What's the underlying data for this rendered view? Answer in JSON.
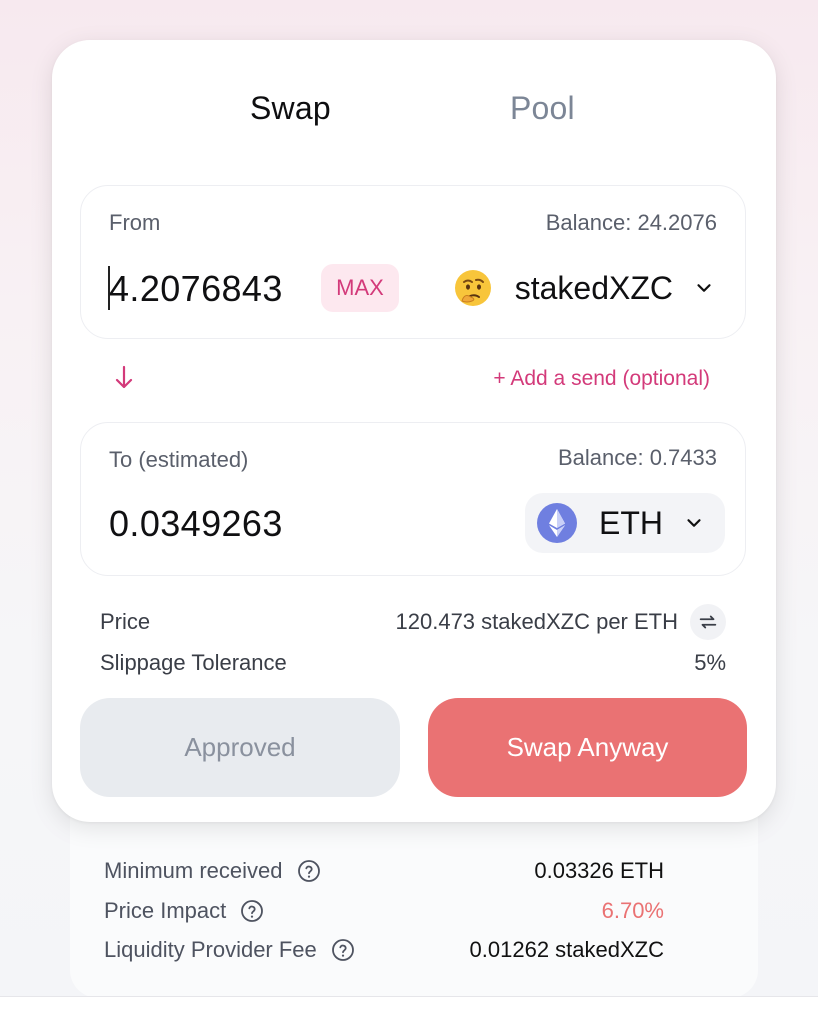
{
  "tabs": {
    "swap": "Swap",
    "pool": "Pool"
  },
  "from": {
    "label": "From",
    "balance": "Balance: 24.2076",
    "amount": "4.2076843",
    "max_label": "MAX",
    "token": "stakedXZC",
    "token_icon": "thinking-face-emoji"
  },
  "add_send": "+ Add a send (optional)",
  "to": {
    "label": "To (estimated)",
    "balance": "Balance: 0.7433",
    "amount": "0.0349263",
    "token": "ETH",
    "token_icon": "ethereum-icon"
  },
  "price": {
    "label": "Price",
    "value": "120.473 stakedXZC per ETH"
  },
  "slippage": {
    "label": "Slippage Tolerance",
    "value": "5%"
  },
  "buttons": {
    "approved": "Approved",
    "swap": "Swap Anyway"
  },
  "details": {
    "min_received_label": "Minimum received",
    "min_received_value": "0.03326 ETH",
    "price_impact_label": "Price Impact",
    "price_impact_value": "6.70%",
    "lp_fee_label": "Liquidity Provider Fee",
    "lp_fee_value": "0.01262 stakedXZC"
  },
  "colors": {
    "accent_pink": "#d33a7a",
    "swap_button": "#ea7273",
    "price_impact": "#ea7273"
  }
}
